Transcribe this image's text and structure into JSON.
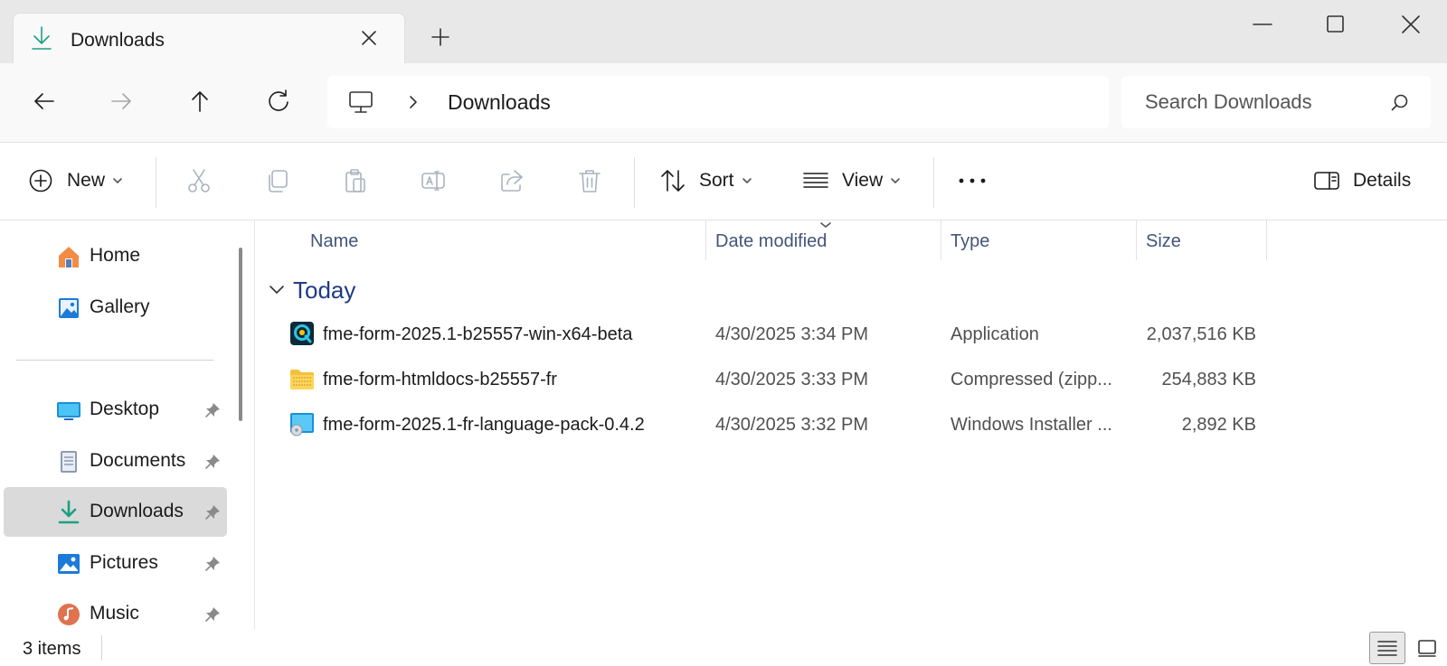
{
  "window": {
    "tab_title": "Downloads",
    "tab_icon": "download-icon",
    "colors": {
      "accent": "#1aa084",
      "group_heading": "#1f3b88"
    }
  },
  "address": {
    "breadcrumb": [
      "This PC",
      "Downloads"
    ],
    "current": "Downloads",
    "search_placeholder": "Search Downloads"
  },
  "commandbar": {
    "new_label": "New",
    "sort_label": "Sort",
    "view_label": "View",
    "details_label": "Details",
    "disabled_actions": [
      "cut",
      "copy",
      "paste",
      "rename",
      "share",
      "delete"
    ]
  },
  "sidebar": {
    "items": [
      {
        "label": "Home",
        "icon": "home-icon",
        "pinned": false
      },
      {
        "label": "Gallery",
        "icon": "gallery-icon",
        "pinned": false
      },
      {
        "label": "Desktop",
        "icon": "desktop-folder-icon",
        "pinned": true
      },
      {
        "label": "Documents",
        "icon": "documents-folder-icon",
        "pinned": true
      },
      {
        "label": "Downloads",
        "icon": "downloads-folder-icon",
        "pinned": true,
        "selected": true
      },
      {
        "label": "Pictures",
        "icon": "pictures-folder-icon",
        "pinned": true
      },
      {
        "label": "Music",
        "icon": "music-folder-icon",
        "pinned": true
      }
    ]
  },
  "filelist": {
    "columns": {
      "name": "Name",
      "date": "Date modified",
      "type": "Type",
      "size": "Size"
    },
    "sort_column": "Date modified",
    "groups": [
      {
        "label": "Today",
        "files": [
          {
            "name": "fme-form-2025.1-b25557-win-x64-beta",
            "date": "4/30/2025 3:34 PM",
            "type": "Application",
            "size": "2,037,516 KB",
            "icon": "application-icon"
          },
          {
            "name": "fme-form-htmldocs-b25557-fr",
            "date": "4/30/2025 3:33 PM",
            "type": "Compressed (zipp...",
            "size": "254,883 KB",
            "icon": "zip-folder-icon"
          },
          {
            "name": "fme-form-2025.1-fr-language-pack-0.4.2",
            "date": "4/30/2025 3:32 PM",
            "type": "Windows Installer ...",
            "size": "2,892 KB",
            "icon": "installer-package-icon"
          }
        ]
      }
    ]
  },
  "statusbar": {
    "item_count": "3 items",
    "view_mode": "details"
  }
}
